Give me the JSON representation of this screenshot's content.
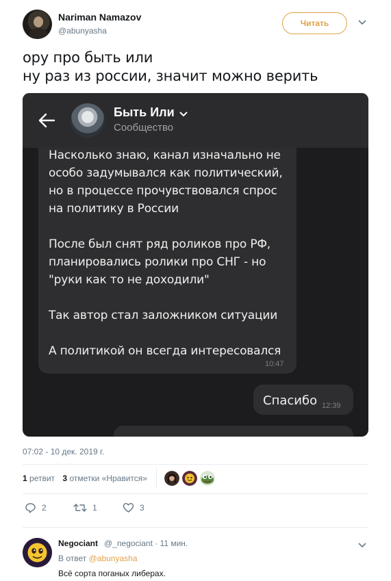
{
  "author": {
    "name": "Nariman Namazov",
    "handle": "@abunyasha",
    "follow_label": "Читать"
  },
  "tweet": {
    "line1": "ору про быть или",
    "line2": "ну раз из россии, значит можно верить",
    "date": "07:02 - 10 дек. 2019 г."
  },
  "screenshot": {
    "channel_title": "Быть Или",
    "channel_subtitle": "Сообщество",
    "message_paragraphs": [
      "Насколько знаю, канал изначально не\nособо задумывался как политический,\nно в процессе прочувствовался спрос\nна политику в России",
      "После был снят ряд роликов про РФ,\nпланировались ролики про СНГ - но\n\"руки как то не доходили\"",
      "Так автор стал заложником ситуации",
      "А политикой он всегда интересовался"
    ],
    "message_time": "10:47",
    "reply_text": "Спасибо",
    "reply_time": "12:39"
  },
  "stats": {
    "retweets": "1",
    "retweets_label": "ретвит",
    "likes": "3",
    "likes_label": "отметки «Нравится»"
  },
  "actions": {
    "replies": "2",
    "retweets": "1",
    "likes": "3"
  },
  "reply": {
    "name": "Negociant",
    "meta": "@_negociant · 11 мин.",
    "to_label": "В ответ",
    "to_handle": "@abunyasha",
    "text": "Всё сорта поганых либерах."
  },
  "colors": {
    "accent": "#e0a24a",
    "muted": "#657786",
    "chat_bg": "#1c1c1e",
    "bubble": "#2e2e30"
  }
}
